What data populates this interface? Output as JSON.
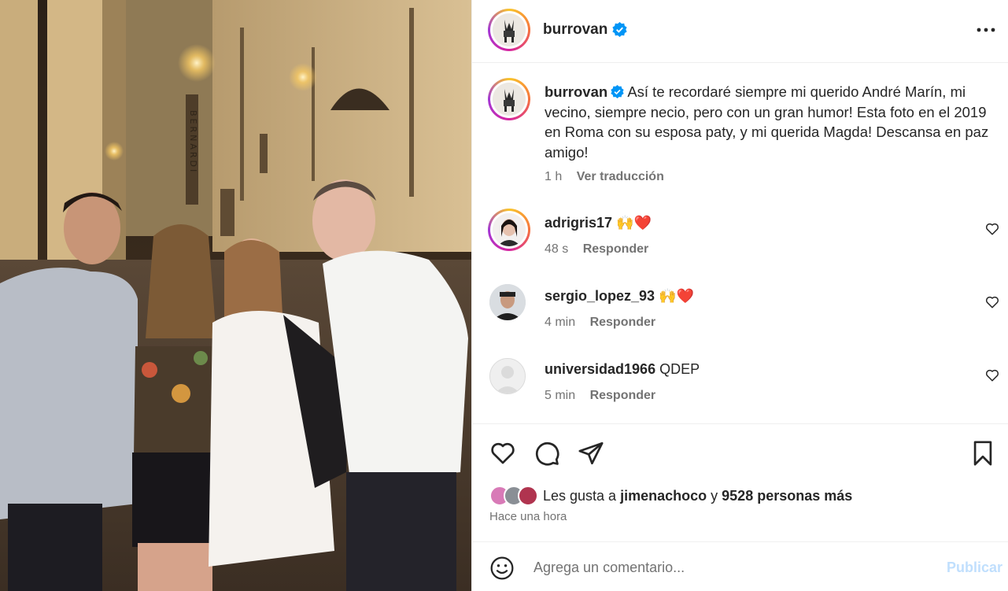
{
  "post": {
    "author": "burrovan",
    "verified": true,
    "more_icon": "more-horizontal-icon"
  },
  "caption": {
    "username": "burrovan",
    "text": "Así te recordaré siempre mi querido André Marín, mi vecino, siempre necio, pero con un gran humor! Esta foto en el 2019 en Roma con su esposa paty, y mi querida Magda! Descansa en paz amigo!",
    "time": "1 h",
    "translate": "Ver traducción"
  },
  "comments": [
    {
      "username": "adrigris17",
      "text": "🙌❤️",
      "time": "48 s",
      "reply": "Responder"
    },
    {
      "username": "sergio_lopez_93",
      "text": "🙌❤️",
      "time": "4 min",
      "reply": "Responder"
    },
    {
      "username": "universidad1966",
      "text": "QDEP",
      "time": "5 min",
      "reply": "Responder"
    }
  ],
  "likes": {
    "prefix": "Les gusta a",
    "user": "jimenachoco",
    "connector": "y",
    "others": "9528 personas más",
    "time_ago": "Hace una hora"
  },
  "add_comment": {
    "placeholder": "Agrega un comentario...",
    "publish": "Publicar"
  },
  "photo": {
    "sign_text": "BERNARDI"
  },
  "colors": {
    "verified_blue": "#0095f6",
    "like_red": "#ed4956",
    "publish_disabled": "#c0dffd",
    "secondary_text": "#737373"
  }
}
